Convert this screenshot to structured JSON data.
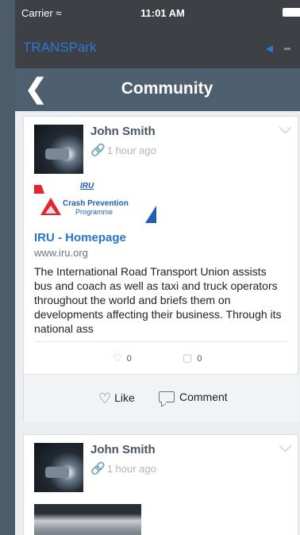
{
  "status_bar": {
    "carrier": "Carrier",
    "wifi_icon": "wifi-icon",
    "time": "11:01 AM"
  },
  "app_bar": {
    "brand": "TRANSPark",
    "action_icon": "send-icon"
  },
  "nav": {
    "back_icon": "chevron-left-icon",
    "back_glyph": "❮",
    "title": "Community"
  },
  "posts": [
    {
      "author": "John Smith",
      "time": "1 hour ago",
      "link": {
        "logo": {
          "iru": "IRU",
          "line1": "Crash Prevention",
          "line2": "Programme"
        },
        "title": "IRU - Homepage",
        "domain": "www.iru.org",
        "description": "The International Road Transport Union assists bus and coach as well as taxi and truck operators throughout the world and briefs them on developments affecting their business. Through its national ass"
      },
      "likes": "0",
      "comments": "0",
      "like_label": "Like",
      "comment_label": "Comment"
    },
    {
      "author": "John Smith",
      "time": "1 hour ago"
    }
  ],
  "colors": {
    "accent": "#2f77d9",
    "nav_bg": "#4e5f70",
    "link": "#2a74c4"
  }
}
